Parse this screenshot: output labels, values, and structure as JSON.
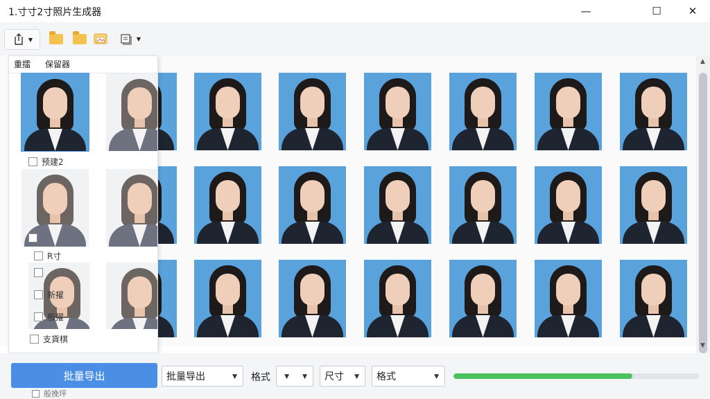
{
  "window": {
    "title": "1.寸寸2寸照片生成器",
    "minimize": "—",
    "maximize": "☐",
    "close": "✕"
  },
  "toolbar": {
    "items": [
      "export-icon",
      "folder-icon",
      "folder-icon",
      "image-folder-icon",
      "document-icon"
    ]
  },
  "panel": {
    "tabs": [
      "重擂",
      "保留器"
    ],
    "items": [
      {
        "label": "预建2"
      },
      {
        "label": ""
      },
      {
        "label": "R寸"
      },
      {
        "label": ""
      },
      {
        "label": "新擢"
      },
      {
        "label": "般擢"
      },
      {
        "label": "支貨棋"
      },
      {
        "label": "般挽坪"
      }
    ]
  },
  "bottom": {
    "primary_button": "批量导出",
    "export_select": "批量导出",
    "format_label": "格式",
    "format_select": "",
    "second_select": "尺寸",
    "third_select": "格式",
    "progress": 0.73
  },
  "colors": {
    "accent": "#4a8fe5",
    "progress": "#4cc15f",
    "photo_bg": "#5aa2dc"
  }
}
